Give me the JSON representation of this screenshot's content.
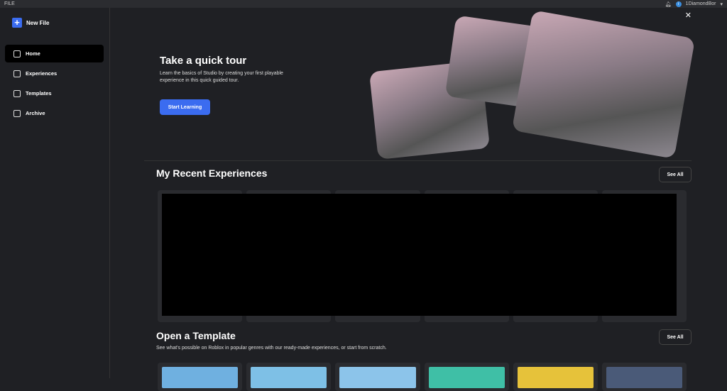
{
  "topbar": {
    "menu": "FILE",
    "username": "1DiamondBor"
  },
  "sidebar": {
    "new_file": "New File",
    "items": [
      {
        "label": "Home"
      },
      {
        "label": "Experiences"
      },
      {
        "label": "Templates"
      },
      {
        "label": "Archive"
      }
    ]
  },
  "tour": {
    "title": "Take a quick tour",
    "description": "Learn the basics of Studio by creating your first playable experience in this quick guided tour.",
    "button": "Start Learning"
  },
  "recent": {
    "title": "My Recent Experiences",
    "see_all": "See All"
  },
  "templates": {
    "title": "Open a Template",
    "subtitle": "See what's possible on Roblox in popular genres with our ready-made experiences, or start from scratch.",
    "see_all": "See All",
    "thumb_colors": [
      "#6fb0e0",
      "#7ec0e6",
      "#8cc4ea",
      "#3fbfa6",
      "#e6c23a",
      "#4a5a78"
    ]
  }
}
